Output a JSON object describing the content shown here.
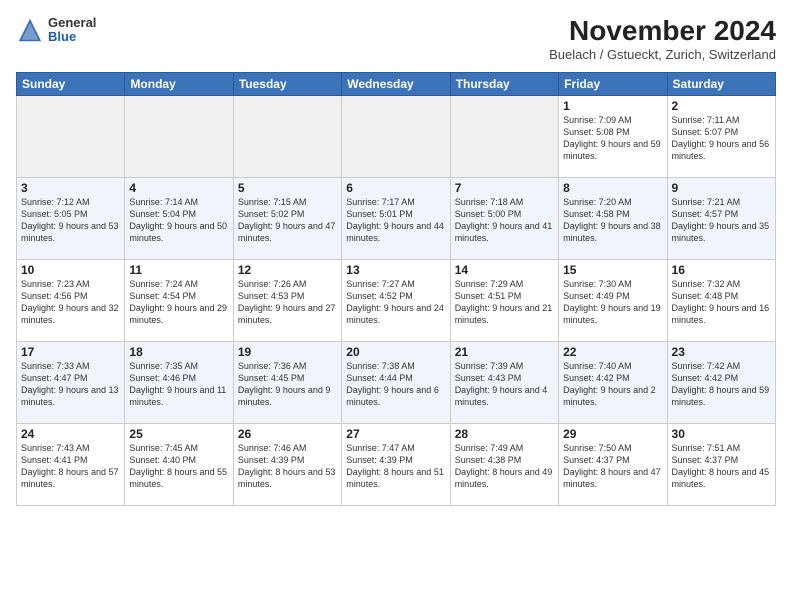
{
  "header": {
    "logo": {
      "general": "General",
      "blue": "Blue"
    },
    "title": "November 2024",
    "subtitle": "Buelach / Gstueckt, Zurich, Switzerland"
  },
  "calendar": {
    "days_of_week": [
      "Sunday",
      "Monday",
      "Tuesday",
      "Wednesday",
      "Thursday",
      "Friday",
      "Saturday"
    ],
    "weeks": [
      [
        {
          "day": "",
          "info": ""
        },
        {
          "day": "",
          "info": ""
        },
        {
          "day": "",
          "info": ""
        },
        {
          "day": "",
          "info": ""
        },
        {
          "day": "",
          "info": ""
        },
        {
          "day": "1",
          "info": "Sunrise: 7:09 AM\nSunset: 5:08 PM\nDaylight: 9 hours and 59 minutes."
        },
        {
          "day": "2",
          "info": "Sunrise: 7:11 AM\nSunset: 5:07 PM\nDaylight: 9 hours and 56 minutes."
        }
      ],
      [
        {
          "day": "3",
          "info": "Sunrise: 7:12 AM\nSunset: 5:05 PM\nDaylight: 9 hours and 53 minutes."
        },
        {
          "day": "4",
          "info": "Sunrise: 7:14 AM\nSunset: 5:04 PM\nDaylight: 9 hours and 50 minutes."
        },
        {
          "day": "5",
          "info": "Sunrise: 7:15 AM\nSunset: 5:02 PM\nDaylight: 9 hours and 47 minutes."
        },
        {
          "day": "6",
          "info": "Sunrise: 7:17 AM\nSunset: 5:01 PM\nDaylight: 9 hours and 44 minutes."
        },
        {
          "day": "7",
          "info": "Sunrise: 7:18 AM\nSunset: 5:00 PM\nDaylight: 9 hours and 41 minutes."
        },
        {
          "day": "8",
          "info": "Sunrise: 7:20 AM\nSunset: 4:58 PM\nDaylight: 9 hours and 38 minutes."
        },
        {
          "day": "9",
          "info": "Sunrise: 7:21 AM\nSunset: 4:57 PM\nDaylight: 9 hours and 35 minutes."
        }
      ],
      [
        {
          "day": "10",
          "info": "Sunrise: 7:23 AM\nSunset: 4:56 PM\nDaylight: 9 hours and 32 minutes."
        },
        {
          "day": "11",
          "info": "Sunrise: 7:24 AM\nSunset: 4:54 PM\nDaylight: 9 hours and 29 minutes."
        },
        {
          "day": "12",
          "info": "Sunrise: 7:26 AM\nSunset: 4:53 PM\nDaylight: 9 hours and 27 minutes."
        },
        {
          "day": "13",
          "info": "Sunrise: 7:27 AM\nSunset: 4:52 PM\nDaylight: 9 hours and 24 minutes."
        },
        {
          "day": "14",
          "info": "Sunrise: 7:29 AM\nSunset: 4:51 PM\nDaylight: 9 hours and 21 minutes."
        },
        {
          "day": "15",
          "info": "Sunrise: 7:30 AM\nSunset: 4:49 PM\nDaylight: 9 hours and 19 minutes."
        },
        {
          "day": "16",
          "info": "Sunrise: 7:32 AM\nSunset: 4:48 PM\nDaylight: 9 hours and 16 minutes."
        }
      ],
      [
        {
          "day": "17",
          "info": "Sunrise: 7:33 AM\nSunset: 4:47 PM\nDaylight: 9 hours and 13 minutes."
        },
        {
          "day": "18",
          "info": "Sunrise: 7:35 AM\nSunset: 4:46 PM\nDaylight: 9 hours and 11 minutes."
        },
        {
          "day": "19",
          "info": "Sunrise: 7:36 AM\nSunset: 4:45 PM\nDaylight: 9 hours and 9 minutes."
        },
        {
          "day": "20",
          "info": "Sunrise: 7:38 AM\nSunset: 4:44 PM\nDaylight: 9 hours and 6 minutes."
        },
        {
          "day": "21",
          "info": "Sunrise: 7:39 AM\nSunset: 4:43 PM\nDaylight: 9 hours and 4 minutes."
        },
        {
          "day": "22",
          "info": "Sunrise: 7:40 AM\nSunset: 4:42 PM\nDaylight: 9 hours and 2 minutes."
        },
        {
          "day": "23",
          "info": "Sunrise: 7:42 AM\nSunset: 4:42 PM\nDaylight: 8 hours and 59 minutes."
        }
      ],
      [
        {
          "day": "24",
          "info": "Sunrise: 7:43 AM\nSunset: 4:41 PM\nDaylight: 8 hours and 57 minutes."
        },
        {
          "day": "25",
          "info": "Sunrise: 7:45 AM\nSunset: 4:40 PM\nDaylight: 8 hours and 55 minutes."
        },
        {
          "day": "26",
          "info": "Sunrise: 7:46 AM\nSunset: 4:39 PM\nDaylight: 8 hours and 53 minutes."
        },
        {
          "day": "27",
          "info": "Sunrise: 7:47 AM\nSunset: 4:39 PM\nDaylight: 8 hours and 51 minutes."
        },
        {
          "day": "28",
          "info": "Sunrise: 7:49 AM\nSunset: 4:38 PM\nDaylight: 8 hours and 49 minutes."
        },
        {
          "day": "29",
          "info": "Sunrise: 7:50 AM\nSunset: 4:37 PM\nDaylight: 8 hours and 47 minutes."
        },
        {
          "day": "30",
          "info": "Sunrise: 7:51 AM\nSunset: 4:37 PM\nDaylight: 8 hours and 45 minutes."
        }
      ]
    ]
  }
}
